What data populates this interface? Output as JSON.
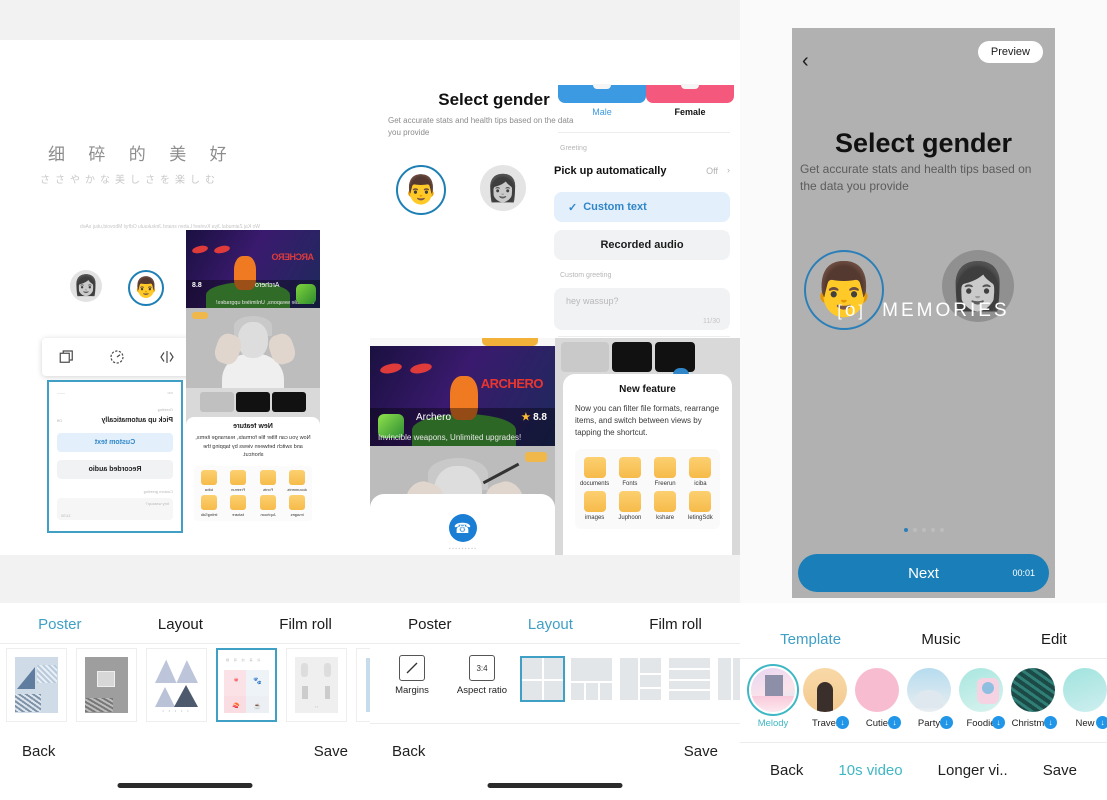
{
  "panel1": {
    "poster_canvas": {
      "cn_title": "细 碎 的 美 好",
      "cn_subtitle": "ささやかな美しさを楽しむ",
      "cn_caption": "Wo Kaj Zaimudal Jiya Kvnteef Lahen snand Jinkukuulu Odhyl Mbovoid,ukuj sAeb",
      "avatar_female_icon": "face-female",
      "avatar_male_icon": "face-male"
    },
    "toolbar": {
      "copy_icon": "duplicate-icon",
      "rotate_icon": "rotate-icon",
      "code_icon": "code-brackets-icon"
    },
    "selected_card": {
      "greeting_label": "Greeting",
      "pick_up_row": "Pick up automatically",
      "pick_up_value": "Off",
      "custom_text": "Custom text",
      "recorded_audio": "Recorded audio",
      "custom_greeting_label": "Custom greeting",
      "custom_greeting_placeholder": "hey wassup?",
      "char_count": "11/30"
    },
    "collage_right": {
      "game_name": "Archero",
      "game_score": "8.8",
      "game_tagline": "Invincible weapons, Unlimited upgrades!",
      "feature_title": "New feature",
      "feature_desc": "Now you can filter file formats, rearrange items, and switch between views by tapping the shortcut.",
      "folders": [
        "documents",
        "Fonts",
        "Freerun",
        "iciba",
        "images",
        "Juphoon",
        "kshare",
        "letingSdk"
      ]
    },
    "tabs": [
      {
        "label": "Poster",
        "active": true
      },
      {
        "label": "Layout",
        "active": false
      },
      {
        "label": "Film roll",
        "active": false
      }
    ],
    "thumbnails": [
      "poster-thumb-1",
      "poster-thumb-2",
      "poster-thumb-3",
      "poster-thumb-4",
      "poster-thumb-5",
      "poster-thumb-6"
    ],
    "selected_thumbnail_index": 3,
    "footer": {
      "back": "Back",
      "save": "Save"
    }
  },
  "panel2": {
    "gender_screen": {
      "title": "Select gender",
      "subtitle": "Get accurate stats and health tips based on the data you provide",
      "avatar_male_icon": "face-male",
      "avatar_female_icon": "face-female"
    },
    "settings_screen": {
      "male_label": "Male",
      "female_label": "Female",
      "male_color": "#3b9ae1",
      "female_color": "#f4597d",
      "greeting_label": "Greeting",
      "pick_up_row": "Pick up automatically",
      "pick_up_value": "Off",
      "chevron": "›",
      "custom_text": "Custom text",
      "check_icon": "check-icon",
      "recorded_audio": "Recorded audio",
      "custom_greeting_label": "Custom greeting",
      "custom_greeting_placeholder": "hey wassup?",
      "char_count": "11/30"
    },
    "collage": {
      "game_name": "Archero",
      "game_score": "8.8",
      "game_star_icon": "star-icon",
      "game_tagline": "Invincible weapons, Unlimited upgrades!",
      "call_icon": "phone-icon",
      "feature_title": "New feature",
      "feature_desc": "Now you can filter file formats, rearrange items, and switch between views by tapping the shortcut.",
      "folders": [
        "documents",
        "Fonts",
        "Freerun",
        "iciba",
        "images",
        "Juphoon",
        "kshare",
        "letingSdk"
      ],
      "filter_icon": "filter-icon"
    },
    "tabs": [
      {
        "label": "Poster",
        "active": false
      },
      {
        "label": "Layout",
        "active": true
      },
      {
        "label": "Film roll",
        "active": false
      }
    ],
    "tools": [
      {
        "label": "Margins",
        "icon": "margins-icon",
        "value": ""
      },
      {
        "label": "Aspect ratio",
        "icon": "aspect-ratio-icon",
        "value": "3:4"
      }
    ],
    "grid_layouts": [
      "grid-2x2",
      "grid-top-3bottom",
      "grid-left-split",
      "grid-rows-4",
      "grid-cols-3"
    ],
    "selected_grid_index": 0,
    "footer": {
      "back": "Back",
      "save": "Save"
    }
  },
  "panel3": {
    "preview_screen": {
      "back_icon": "chevron-left-icon",
      "preview_button": "Preview",
      "title": "Select gender",
      "subtitle": "Get accurate stats and health tips based on the data you provide",
      "avatar_male_icon": "face-male",
      "avatar_female_icon": "face-female",
      "watermark": "MEMORIES",
      "watermark_bracket_left": "[",
      "watermark_bracket_right": "]",
      "watermark_lens": "o",
      "next_button": "Next",
      "duration": "00:01",
      "page_dots": 5,
      "active_dot_index": 0
    },
    "tabs": [
      {
        "label": "Template",
        "active": true
      },
      {
        "label": "Music",
        "active": false
      },
      {
        "label": "Edit",
        "active": false
      }
    ],
    "templates": [
      {
        "label": "Melody",
        "selected": true,
        "downloadable": false
      },
      {
        "label": "Travel",
        "selected": false,
        "downloadable": true
      },
      {
        "label": "Cutie",
        "selected": false,
        "downloadable": true
      },
      {
        "label": "Party",
        "selected": false,
        "downloadable": true
      },
      {
        "label": "Foodie",
        "selected": false,
        "downloadable": true
      },
      {
        "label": "Christmas",
        "selected": false,
        "downloadable": true
      },
      {
        "label": "New",
        "selected": false,
        "downloadable": true
      }
    ],
    "footer": {
      "back": "Back",
      "short_video": "10s video",
      "long_video": "Longer vi..",
      "save": "Save"
    }
  },
  "colors": {
    "accent": "#3f9fc4",
    "accent_teal": "#3fb7c4",
    "primary_blue": "#1a7fb8",
    "download_blue": "#2196e8"
  }
}
